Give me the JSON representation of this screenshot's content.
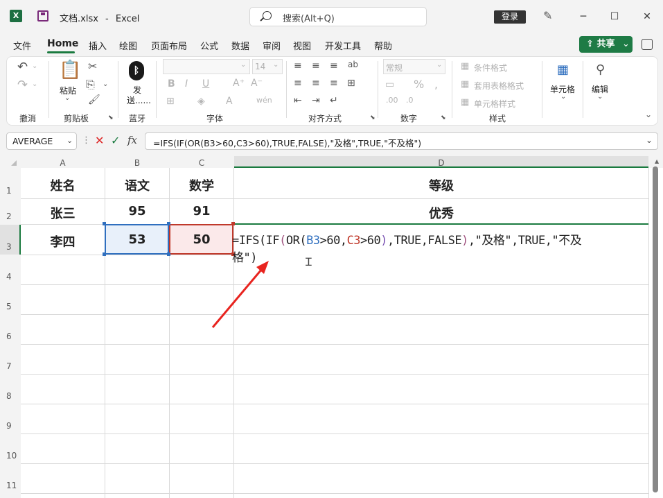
{
  "app": {
    "file_name": "文档.xlsx",
    "app_name": "Excel",
    "title_sep": "-"
  },
  "search": {
    "placeholder": "搜索(Alt+Q)"
  },
  "titlebar": {
    "login": "登录",
    "minimize": "─",
    "maximize": "☐",
    "close": "✕"
  },
  "menu": {
    "tabs": [
      "文件",
      "Home",
      "插入",
      "绘图",
      "页面布局",
      "公式",
      "数据",
      "审阅",
      "视图",
      "开发工具",
      "帮助"
    ],
    "active": "Home",
    "share": "共享"
  },
  "ribbon": {
    "undo_group": "撤消",
    "clipboard": {
      "paste": "粘贴",
      "label": "剪贴板"
    },
    "bluetooth": {
      "send_line1": "发",
      "send_line2": "送......",
      "label": "蓝牙"
    },
    "font": {
      "label": "字体",
      "size": "14"
    },
    "align": {
      "label": "对齐方式"
    },
    "number": {
      "format": "常规",
      "label": "数字"
    },
    "styles": {
      "conditional": "条件格式",
      "table": "套用表格格式",
      "cell": "单元格样式",
      "label": "样式"
    },
    "cells": {
      "label": "单元格"
    },
    "edit": {
      "label": "编辑"
    }
  },
  "formula_bar": {
    "name_box": "AVERAGE",
    "fx": "fx",
    "formula": "=IFS(IF(OR(B3>60,C3>60),TRUE,FALSE),\"及格\",TRUE,\"不及格\")"
  },
  "columns": [
    "A",
    "B",
    "C",
    "D"
  ],
  "rows": [
    "1",
    "2",
    "3",
    "4",
    "5",
    "6",
    "7",
    "8",
    "9",
    "10",
    "11"
  ],
  "cells": {
    "a1": "姓名",
    "b1": "语文",
    "c1": "数学",
    "d1": "等级",
    "a2": "张三",
    "b2": "95",
    "c2": "91",
    "d2": "优秀",
    "a3": "李四",
    "b3": "53",
    "c3": "50"
  },
  "edit_formula": {
    "p1": "=IFS(IF",
    "p2": "(",
    "p3": "OR(",
    "b3": "B3",
    "p4": ">60,",
    "c3": "C3",
    "p5": ">60",
    "p6": ")",
    "p7": ",TRUE,FALSE",
    "p8": ")",
    "p9": ",\"及格\",TRUE,\"不及",
    "line2": "格\")"
  },
  "colors": {
    "accent": "#1e7b45",
    "ref_b3": "#2f6fbf",
    "ref_c3": "#c0392b",
    "arrow": "#e8241f"
  }
}
